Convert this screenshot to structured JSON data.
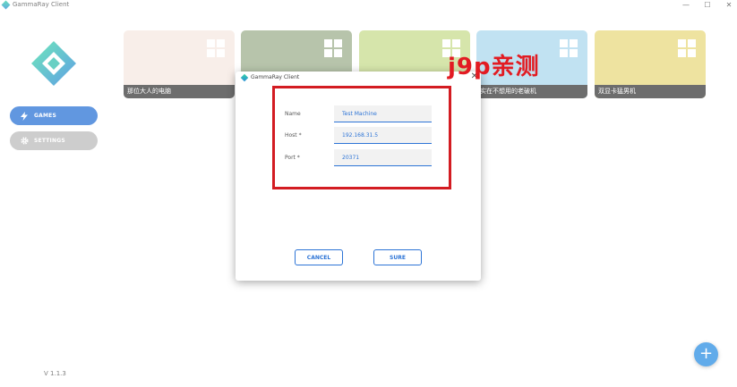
{
  "window": {
    "title": "GammaRay Client",
    "minimize": "—",
    "maximize": "☐",
    "close": "✕"
  },
  "sidebar": {
    "items": [
      {
        "label": "GAMES",
        "icon": "bolt-icon",
        "active": true
      },
      {
        "label": "SETTINGS",
        "icon": "gear-icon",
        "active": false
      }
    ],
    "version": "V 1.1.3"
  },
  "cards": [
    {
      "label": "那位大人的电脑",
      "color": "#f6e9e2"
    },
    {
      "label": "",
      "color": "#9fb18f"
    },
    {
      "label": "",
      "color": "#c9dc8f"
    },
    {
      "label": "实在不想用的老破机",
      "color": "#add9ee"
    },
    {
      "label": "双显卡猛男机",
      "color": "#e8da80"
    }
  ],
  "watermark": "j9p亲测",
  "dialog": {
    "title": "GammaRay Client",
    "close": "✕",
    "fields": {
      "name": {
        "label": "Name",
        "value": "Test Machine"
      },
      "host": {
        "label": "Host *",
        "value": "192.168.31.5"
      },
      "port": {
        "label": "Port *",
        "value": "20371"
      }
    },
    "cancel_label": "CANCEL",
    "sure_label": "SURE"
  },
  "fab": {
    "label": "+"
  },
  "colors": {
    "accent": "#2d74d6",
    "highlight": "#d31c22"
  }
}
